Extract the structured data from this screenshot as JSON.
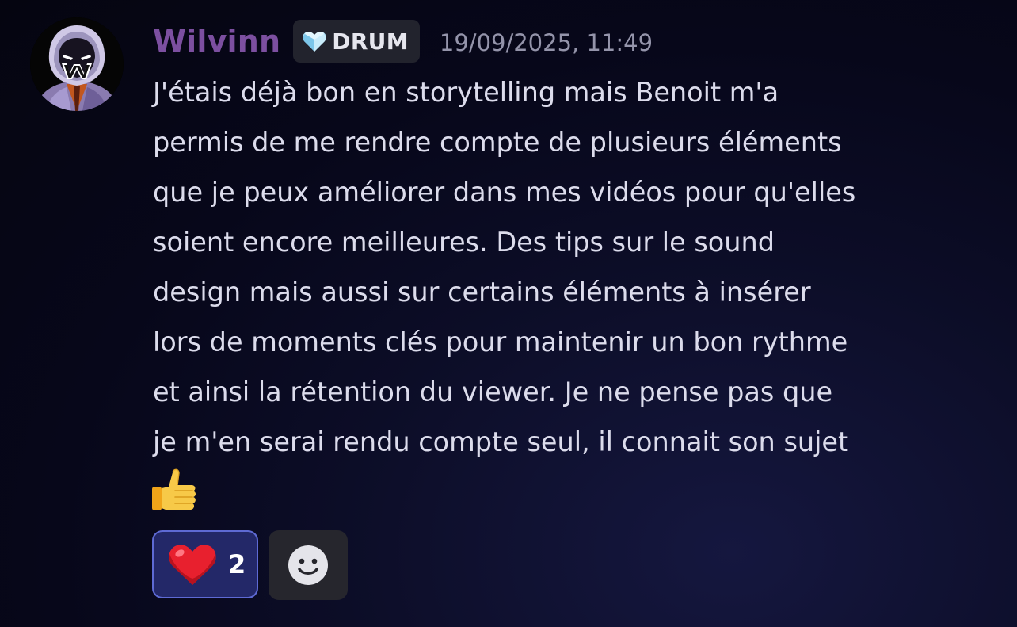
{
  "message": {
    "username": "Wilvinn",
    "tag": {
      "label": "DRUM",
      "icon": "heart-gem-icon"
    },
    "timestamp": "19/09/2025, 11:49",
    "lines": [
      "J'étais déjà bon en storytelling mais Benoit m'a",
      "permis de me rendre compte de plusieurs éléments",
      "que je peux améliorer dans mes vidéos pour qu'elles",
      "soient encore meilleures. Des tips sur le sound",
      "design mais aussi sur certains éléments à insérer",
      "lors de moments clés pour maintenir un bon rythme",
      "et ainsi la rétention du viewer. Je ne pense pas que",
      "je m'en serai rendu compte seul, il connait son sujet"
    ],
    "emoji": "thumbs-up-emoji"
  },
  "reactions": [
    {
      "emoji": "red-heart-emoji",
      "count": "2",
      "active": true
    }
  ],
  "add_reaction": {
    "icon": "smiley-face-icon"
  },
  "colors": {
    "username": "#7c4fa0",
    "reaction_active_bg": "#232868",
    "reaction_active_border": "#5e6ad4",
    "text": "#dcdcec",
    "timestamp": "#9494aa"
  }
}
